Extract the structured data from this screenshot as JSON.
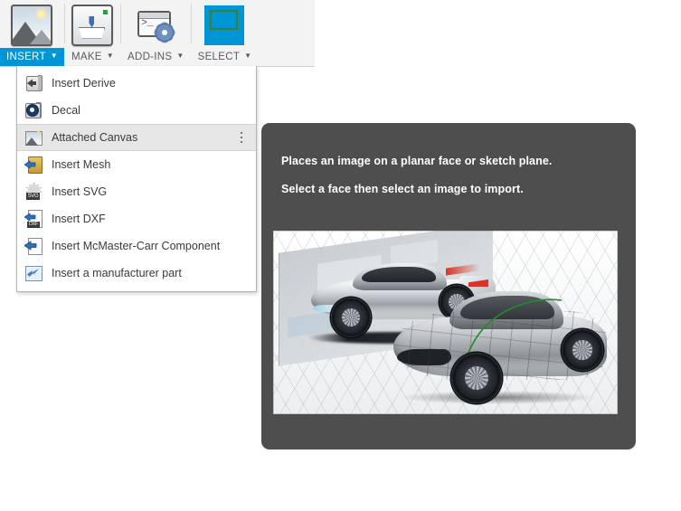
{
  "toolbar": {
    "items": [
      {
        "label": "INSERT",
        "icon": "image-icon",
        "caret": "▼",
        "active": true
      },
      {
        "label": "MAKE",
        "icon": "3d-printer-icon",
        "caret": "▼",
        "active": false
      },
      {
        "label": "ADD-INS",
        "icon": "terminal-gear-icon",
        "caret": "▼",
        "active": false
      },
      {
        "label": "SELECT",
        "icon": "select-cursor-icon",
        "caret": "▼",
        "active": false
      }
    ],
    "active_color": "#0096d6",
    "label_color": "#5a5a5a"
  },
  "menu": {
    "items": [
      {
        "label": "Insert Derive",
        "icon": "derive-icon",
        "highlighted": false,
        "has_overflow": false
      },
      {
        "label": "Decal",
        "icon": "decal-icon",
        "highlighted": false,
        "has_overflow": false
      },
      {
        "label": "Attached Canvas",
        "icon": "attached-canvas-icon",
        "highlighted": true,
        "has_overflow": true
      },
      {
        "label": "Insert Mesh",
        "icon": "insert-mesh-icon",
        "highlighted": false,
        "has_overflow": false
      },
      {
        "label": "Insert SVG",
        "icon": "insert-svg-icon",
        "highlighted": false,
        "has_overflow": false
      },
      {
        "label": "Insert DXF",
        "icon": "insert-dxf-icon",
        "highlighted": false,
        "has_overflow": false
      },
      {
        "label": "Insert McMaster-Carr Component",
        "icon": "mcmaster-carr-icon",
        "highlighted": false,
        "has_overflow": false
      },
      {
        "label": "Insert a manufacturer part",
        "icon": "manufacturer-part-icon",
        "highlighted": false,
        "has_overflow": false
      }
    ],
    "overflow_glyph": "⋮",
    "highlight_color": "#e6e6e6"
  },
  "tooltip": {
    "lines": [
      "Places an image on a planar face or sketch plane.",
      "Select a face then select an image to import."
    ],
    "background_color": "#4e4e4e",
    "text_color": "#ffffff",
    "preview_alt": "Car design sketch on a backdrop plane next to a 3D surface-modelled car"
  },
  "icon_glyphs": {
    "svg_tag": "SVG",
    "dxf_tag": "DXF",
    "terminal_prompt": ">_"
  }
}
